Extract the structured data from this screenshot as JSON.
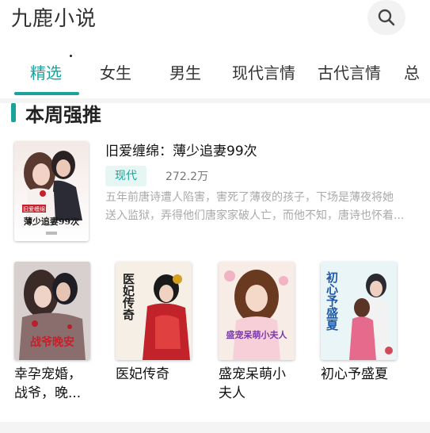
{
  "app": {
    "title": "九鹿小说"
  },
  "tabs": [
    {
      "label": "精选"
    },
    {
      "label": "女生"
    },
    {
      "label": "男生"
    },
    {
      "label": "现代言情"
    },
    {
      "label": "古代言情"
    },
    {
      "label": "总"
    }
  ],
  "section": {
    "title": "本周强推"
  },
  "featured": {
    "title": "旧爱缠绵：薄少追妻99次",
    "tag": "现代",
    "count": "272.2万",
    "desc_line1": "五年前唐诗遭人陷害，害死了薄夜的孩子，下场是薄夜将她",
    "desc_line2": "送入监狱，弄得他们唐家家破人亡，而他不知，唐诗也怀着...",
    "cover_text": "薄少追妻99次",
    "cover_badge": "旧爱缠绵"
  },
  "books": [
    {
      "title_line1": "幸孕宠婚，",
      "title_line2": "战爷，晚...",
      "cover_text": "战爷晚安"
    },
    {
      "title_line1": "医妃传奇",
      "title_line2": "",
      "cover_text": "医妃传奇"
    },
    {
      "title_line1": "盛宠呆萌小",
      "title_line2": "夫人",
      "cover_text": "盛宠呆萌小夫人"
    },
    {
      "title_line1": "初心予盛夏",
      "title_line2": "",
      "cover_text": "初心予盛夏"
    }
  ],
  "colors": {
    "accent": "#1aa39a",
    "tag_bg": "#e6f7f3",
    "muted": "#aaaaaa"
  },
  "icons": {
    "search": "search-icon"
  }
}
